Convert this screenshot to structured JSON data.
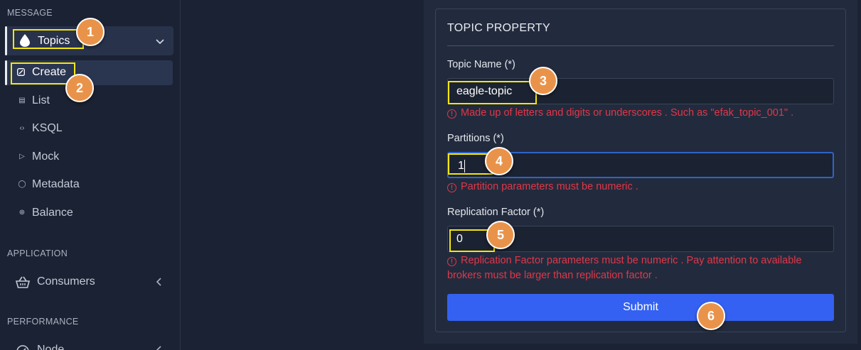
{
  "sidebar": {
    "sections": {
      "message": "MESSAGE",
      "application": "APPLICATION",
      "performance": "PERFORMANCE"
    },
    "topics_label": "Topics",
    "create_label": "Create",
    "sub_items": [
      {
        "label": "List",
        "icon": "list-icon"
      },
      {
        "label": "KSQL",
        "icon": "code-icon"
      },
      {
        "label": "Mock",
        "icon": "send-icon"
      },
      {
        "label": "Metadata",
        "icon": "database-icon"
      },
      {
        "label": "Balance",
        "icon": "balance-icon"
      }
    ],
    "consumers_label": "Consumers",
    "node_label": "Node"
  },
  "form": {
    "title": "TOPIC PROPERTY",
    "topic_name": {
      "label": "Topic Name (*)",
      "value": "eagle-topic",
      "error": "Made up of letters and digits or underscores . Such as \"efak_topic_001\" ."
    },
    "partitions": {
      "label": "Partitions (*)",
      "value": "1",
      "error": "Partition parameters must be numeric ."
    },
    "replication_factor": {
      "label": "Replication Factor (*)",
      "value": "0",
      "error": "Replication Factor parameters must be numeric . Pay attention to available brokers must be larger than replication factor ."
    },
    "submit_label": "Submit"
  },
  "steps": [
    "1",
    "2",
    "3",
    "4",
    "5",
    "6"
  ],
  "colors": {
    "highlight": "#f5e60f",
    "badge": "#e9934a",
    "error": "#e0374a",
    "primary": "#3461f2"
  }
}
